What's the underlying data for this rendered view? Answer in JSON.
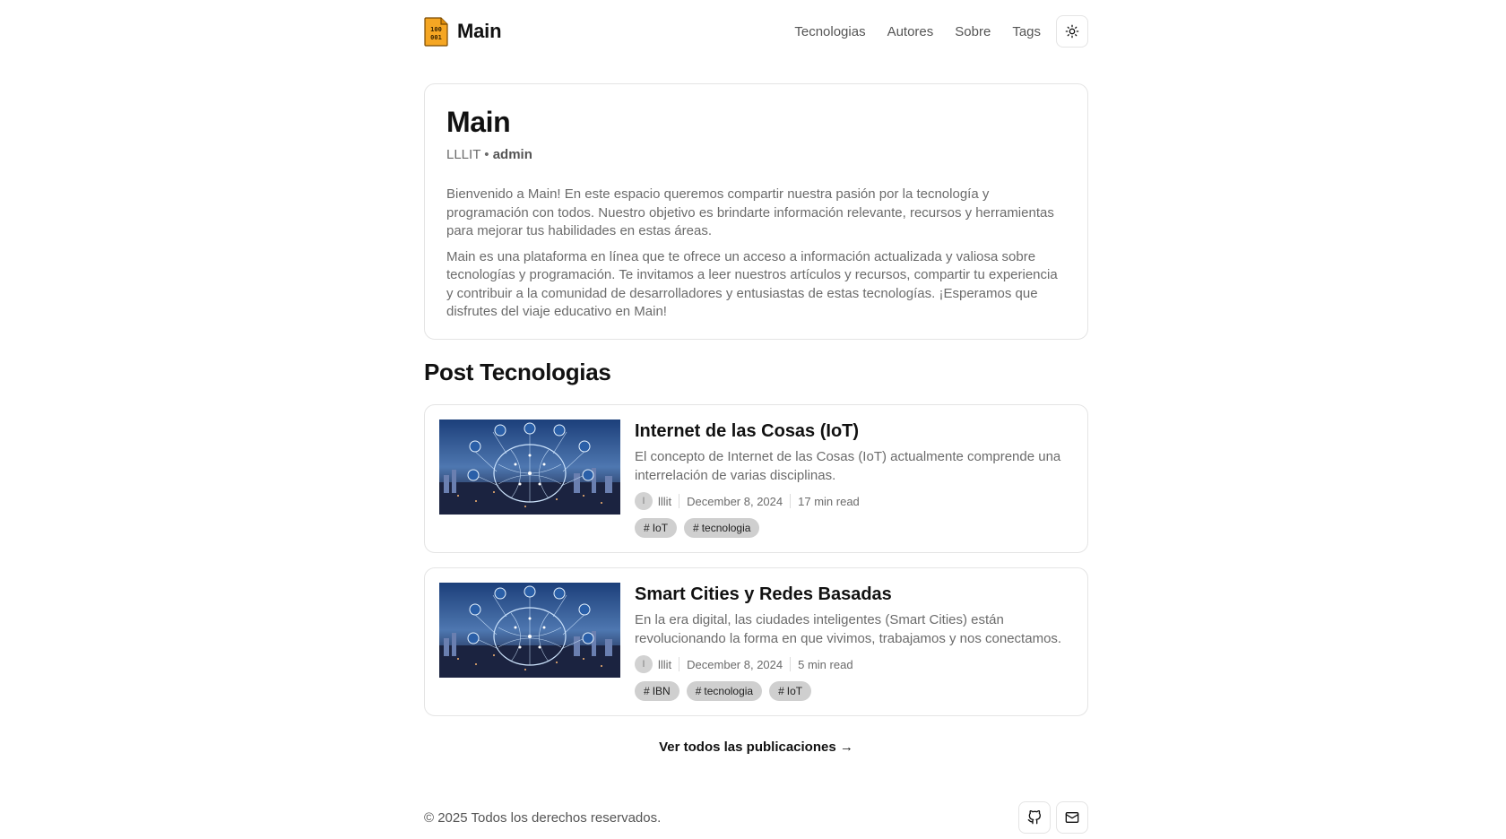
{
  "header": {
    "brand_title": "Main",
    "nav": [
      "Tecnologias",
      "Autores",
      "Sobre",
      "Tags"
    ]
  },
  "intro": {
    "title": "Main",
    "meta_site": "LLLIT",
    "meta_role": "admin",
    "paragraph1": "Bienvenido a Main! En este espacio queremos compartir nuestra pasión por la tecnología y programación con todos. Nuestro objetivo es brindarte información relevante, recursos y herramientas para mejorar tus habilidades en estas áreas.",
    "paragraph2": "Main es una plataforma en línea que te ofrece un acceso a información actualizada y valiosa sobre tecnologías y programación. Te invitamos a leer nuestros artículos y recursos, compartir tu experiencia y contribuir a la comunidad de desarrolladores y entusiastas de estas tecnologías. ¡Esperamos que disfrutes del viaje educativo en Main!"
  },
  "section_title": "Post Tecnologias",
  "posts": [
    {
      "title": "Internet de las Cosas (IoT)",
      "excerpt": "El concepto de Internet de las Cosas (IoT) actualmente comprende una interrelación de varias disciplinas.",
      "avatar_initial": "l",
      "author": "lllit",
      "date": "December 8, 2024",
      "read_time": "17 min read",
      "tags": [
        "IoT",
        "tecnologia"
      ]
    },
    {
      "title": "Smart Cities y Redes Basadas",
      "excerpt": "En la era digital, las ciudades inteligentes (Smart Cities) están revolucionando la forma en que vivimos, trabajamos y nos conectamos.",
      "avatar_initial": "l",
      "author": "lllit",
      "date": "December 8, 2024",
      "read_time": "5 min read",
      "tags": [
        "IBN",
        "tecnologia",
        "IoT"
      ]
    }
  ],
  "view_all": "Ver todos las publicaciones →",
  "footer": {
    "copyright": "© 2025 Todos los derechos reservados.",
    "icons": [
      "github-icon",
      "mail-icon"
    ]
  },
  "colors": {
    "logo_orange": "#f5a623",
    "tag_bg": "#cfcfcf",
    "border": "#e4e4e4"
  }
}
